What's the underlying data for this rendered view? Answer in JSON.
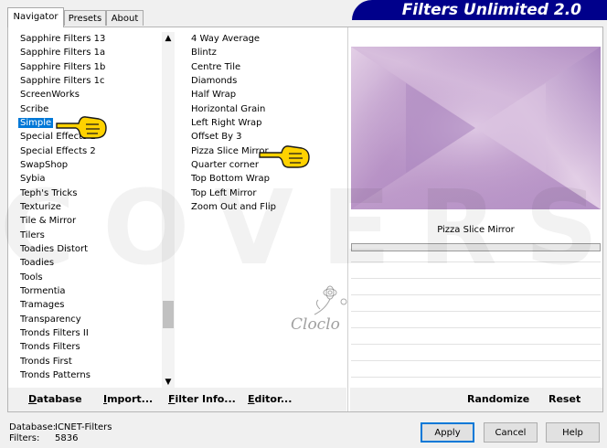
{
  "window": {
    "title": "Filters Unlimited 2.0"
  },
  "tabs": [
    {
      "label": "Navigator",
      "active": true
    },
    {
      "label": "Presets",
      "active": false
    },
    {
      "label": "About",
      "active": false
    }
  ],
  "categories": {
    "items": [
      "Sapphire Filters 13",
      "Sapphire Filters 1a",
      "Sapphire Filters 1b",
      "Sapphire Filters 1c",
      "ScreenWorks",
      "Scribe",
      "Simple",
      "Special Effects 1",
      "Special Effects 2",
      "SwapShop",
      "Sybia",
      "Teph's Tricks",
      "Texturize",
      "Tile & Mirror",
      "Tilers",
      "Toadies Distort",
      "Toadies",
      "Tools",
      "Tormentia",
      "Tramages",
      "Transparency",
      "Tronds Filters II",
      "Tronds Filters",
      "Tronds First",
      "Tronds Patterns"
    ],
    "selected": "Simple"
  },
  "filters": {
    "items": [
      "4 Way Average",
      "Blintz",
      "Centre Tile",
      "Diamonds",
      "Half Wrap",
      "Horizontal Grain",
      "Left Right Wrap",
      "Offset By 3",
      "Pizza Slice Mirror",
      "Quarter corner",
      "Top Bottom Wrap",
      "Top Left Mirror",
      "Zoom Out and Flip"
    ],
    "selected": "Pizza Slice Mirror"
  },
  "preview": {
    "filter_name": "Pizza Slice Mirror",
    "colors": [
      "#c5a4cf",
      "#a884be",
      "#e3cfe6",
      "#b893c6"
    ]
  },
  "left_buttons": [
    {
      "label": "Database",
      "underline": "D",
      "rest": "atabase"
    },
    {
      "label": "Import...",
      "underline": "I",
      "rest": "mport..."
    },
    {
      "label": "Filter Info...",
      "underline": "F",
      "rest": "ilter Info..."
    },
    {
      "label": "Editor...",
      "underline": "E",
      "rest": "ditor..."
    }
  ],
  "right_buttons": {
    "randomize": "Randomize",
    "reset": "Reset"
  },
  "footer": {
    "database_label": "Database:",
    "database_value": "ICNET-Filters",
    "filters_label": "Filters:",
    "filters_value": "5836"
  },
  "dialog_buttons": {
    "apply": "Apply",
    "cancel": "Cancel",
    "help": "Help"
  },
  "watermark": {
    "text": "COVERS",
    "signature": "Cloclo"
  },
  "accent_colors": {
    "selection": "#0078d7",
    "banner": "#00008b",
    "pointer": "#ffd200"
  },
  "icons": [
    "hand-pointer-icon",
    "chevron-up-icon",
    "chevron-down-icon",
    "flower-watermark-icon"
  ]
}
